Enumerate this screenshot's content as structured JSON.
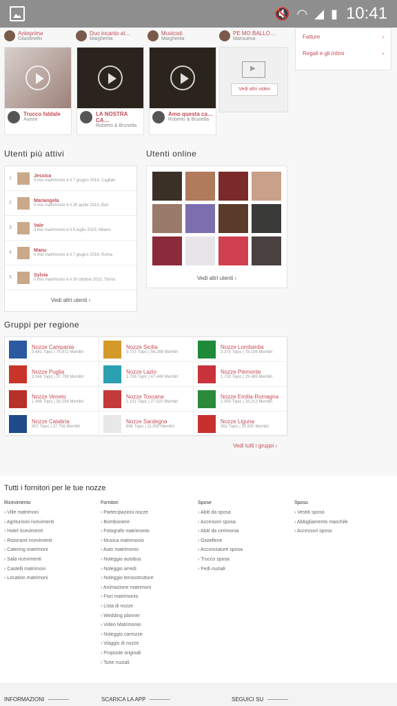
{
  "status_bar": {
    "time": "10:41"
  },
  "top_strip": [
    {
      "title": "Anteprima",
      "sub": "Gilardinello"
    },
    {
      "title": "Duo incanto al…",
      "sub": "Margherita"
    },
    {
      "title": "Musicisti",
      "sub": "Margherita"
    },
    {
      "title": "PE MO BALLO…",
      "sub": "Mansueva"
    }
  ],
  "right_box": {
    "rows": [
      "Fatture",
      "Regali e gli intimi"
    ]
  },
  "videos": [
    {
      "title": "Trucco faldale",
      "sub": "Autore",
      "light": true
    },
    {
      "title": "LA NOSTRA CA…",
      "sub": "Roberto &\nBrunella",
      "light": false
    },
    {
      "title": "Amo questa ca…",
      "sub": "Roberto &\nBrunella",
      "light": false
    }
  ],
  "see_all_videos": "Vedi altri video",
  "users_title": "Utenti più attivi",
  "users": [
    {
      "n": "1",
      "name": "Jessica",
      "sub": "Il mio matrimonio è il 7 giugno 2014, Cagliari"
    },
    {
      "n": "2",
      "name": "Mariangela",
      "sub": "Il mio matrimonio è il 26 aprile 2015, Bari"
    },
    {
      "n": "3",
      "name": "Vale",
      "sub": "Il mio matrimonio è il 5 luglio 2015, Milano"
    },
    {
      "n": "4",
      "name": "Manu",
      "sub": "Il mio matrimonio è il 7 giugno 2016, Roma"
    },
    {
      "n": "5",
      "name": "Sylvia",
      "sub": "Il mio matrimonio è il 30 ottobre 2015, Torino"
    }
  ],
  "users_more": "Vedi altri utenti",
  "online_title": "Utenti online",
  "online_more": "Vedi altri utenti",
  "online_colors": [
    "#3a3026",
    "#b07a5c",
    "#7a2a2a",
    "#c9a08a",
    "#9a7a6a",
    "#7b6fb0",
    "#5a3a2a",
    "#3a3a38",
    "#8a2a3a",
    "#e8e4e8",
    "#d04050",
    "#4a4040"
  ],
  "regions_title": "Gruppi per regione",
  "regions": [
    {
      "name": "Nozze Campania",
      "sub": "5.481 Topic | 75.972 Membri",
      "color": "#2c5aa0"
    },
    {
      "name": "Nozze Sicilia",
      "sub": "3.737 Topic | 56.288 Membri",
      "color": "#d39a2a"
    },
    {
      "name": "Nozze Lombardia",
      "sub": "3.375 Topic | 78.156 Membri",
      "color": "#1f8a3a"
    },
    {
      "name": "Nozze Puglia",
      "sub": "3.346 Topic | 37.799 Membri",
      "color": "#c9342a"
    },
    {
      "name": "Nozze Lazio",
      "sub": "2.793 Topic | 47.446 Membri",
      "color": "#2aa0b0"
    },
    {
      "name": "Nozze Piemonte",
      "sub": "1.720 Topic | 29.485 Membri",
      "color": "#c8323a"
    },
    {
      "name": "Nozze Veneto",
      "sub": "1.468 Topic | 30.254 Membri",
      "color": "#b8302a"
    },
    {
      "name": "Nozze Toscana",
      "sub": "1.151 Topic | 27.020 Membri",
      "color": "#c23a3a"
    },
    {
      "name": "Nozze Emilia-Romagna",
      "sub": "1.059 Topic | 28.212 Membri",
      "color": "#2a8a3a"
    },
    {
      "name": "Nozze Calabria",
      "sub": "957 Topic | 17.756 Membri",
      "color": "#1f4a8a"
    },
    {
      "name": "Nozze Sardegna",
      "sub": "696 Topic | 11.950 Membri",
      "color": "#e8e8e8"
    },
    {
      "name": "Nozze Liguria",
      "sub": "362 Topic | 10.930 Membri",
      "color": "#c83030"
    }
  ],
  "all_groups": "Vedi tutti i gruppi",
  "suppliers_title": "Tutti i fornitori per le tue nozze",
  "supplier_cols": [
    {
      "head": "Ricevimento",
      "items": [
        "Ville matrimoni",
        "Agriturismi ricevimenti",
        "Hotel ricevimenti",
        "Ristoranti ricevimenti",
        "Catering matrimoni",
        "Sala ricevimenti",
        "Castelli matrimoni",
        "Location matrimoni"
      ]
    },
    {
      "head": "Fornitori",
      "items": [
        "Partecipazioni nozze",
        "Bomboniere",
        "Fotografo matrimonio",
        "Musica matrimonio",
        "Auto matrimonio",
        "Noleggio autobus",
        "Noleggio arredi",
        "Noleggio tensostrutture",
        "Animazione matrimoni",
        "Fiori matrimonio",
        "Lista di nozze",
        "Wedding planner",
        "Video Matrimonio",
        "Noleggio carrozze",
        "Viaggio di nozze",
        "Proposte originali",
        "Torte nuziali"
      ]
    },
    {
      "head": "Spose",
      "items": [
        "Abiti da sposa",
        "Accessori sposa",
        "Abiti da cerimonia",
        "Gioiellerie",
        "Acconciature sposa",
        "Trucco sposa",
        "Fedi nuziali"
      ]
    },
    {
      "head": "Sposo",
      "items": [
        "Vestiti sposo",
        "Abbigliamento maschile",
        "Accessori sposo"
      ]
    }
  ],
  "footer": [
    "INFORMAZIONI",
    "SCARICA LA APP",
    "SEGUICI SU"
  ]
}
